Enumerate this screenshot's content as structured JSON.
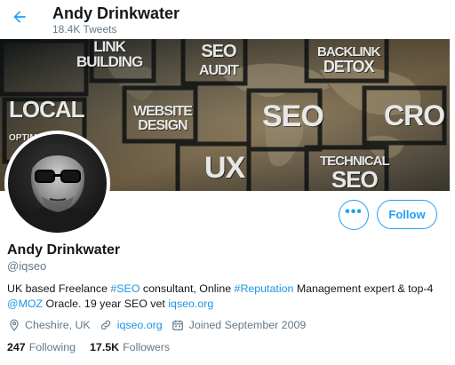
{
  "header": {
    "title": "Andy Drinkwater",
    "subtitle": "18.4K Tweets",
    "back_icon": "arrow-left-icon"
  },
  "banner": {
    "words": [
      "LINK BUILDING",
      "SEO AUDIT",
      "BACKLINK DETOX",
      "LOCAL OPTIMISATION",
      "WEBSITE DESIGN",
      "SEO",
      "CRO",
      "UX",
      "TECHNICAL SEO"
    ],
    "w1a": "LINK",
    "w1b": "BUILDING",
    "w2a": "SEO",
    "w2b": "AUDIT",
    "w3a": "BACKLINK",
    "w3b": "DETOX",
    "w4a": "LOCAL",
    "w4b": "OPTIMISATION",
    "w5a": "WEBSITE",
    "w5b": "DESIGN",
    "w6": "SEO",
    "w7": "CRO",
    "w8": "UX",
    "w9a": "TECHNICAL",
    "w9b": "SEO"
  },
  "buttons": {
    "more_label": "•••",
    "follow_label": "Follow"
  },
  "profile": {
    "name": "Andy Drinkwater",
    "handle": "@iqseo",
    "bio": {
      "t1": "UK based Freelance ",
      "l1": "#SEO",
      "t2": " consultant, Online ",
      "l2": "#Reputation",
      "t3": " Management expert & top-4 ",
      "l3": "@MOZ",
      "t4": " Oracle. 19 year SEO vet ",
      "l4": "iqseo.org"
    },
    "location": "Cheshire, UK",
    "website": "iqseo.org",
    "joined": "Joined September 2009",
    "following_count": "247",
    "following_label": "Following",
    "followers_count": "17.5K",
    "followers_label": "Followers"
  },
  "colors": {
    "accent": "#1da1f2",
    "link": "#1b95e0",
    "muted": "#657786",
    "text": "#14171a"
  },
  "icons": [
    "arrow-left-icon",
    "more-icon",
    "location-pin-icon",
    "link-icon",
    "calendar-icon"
  ]
}
